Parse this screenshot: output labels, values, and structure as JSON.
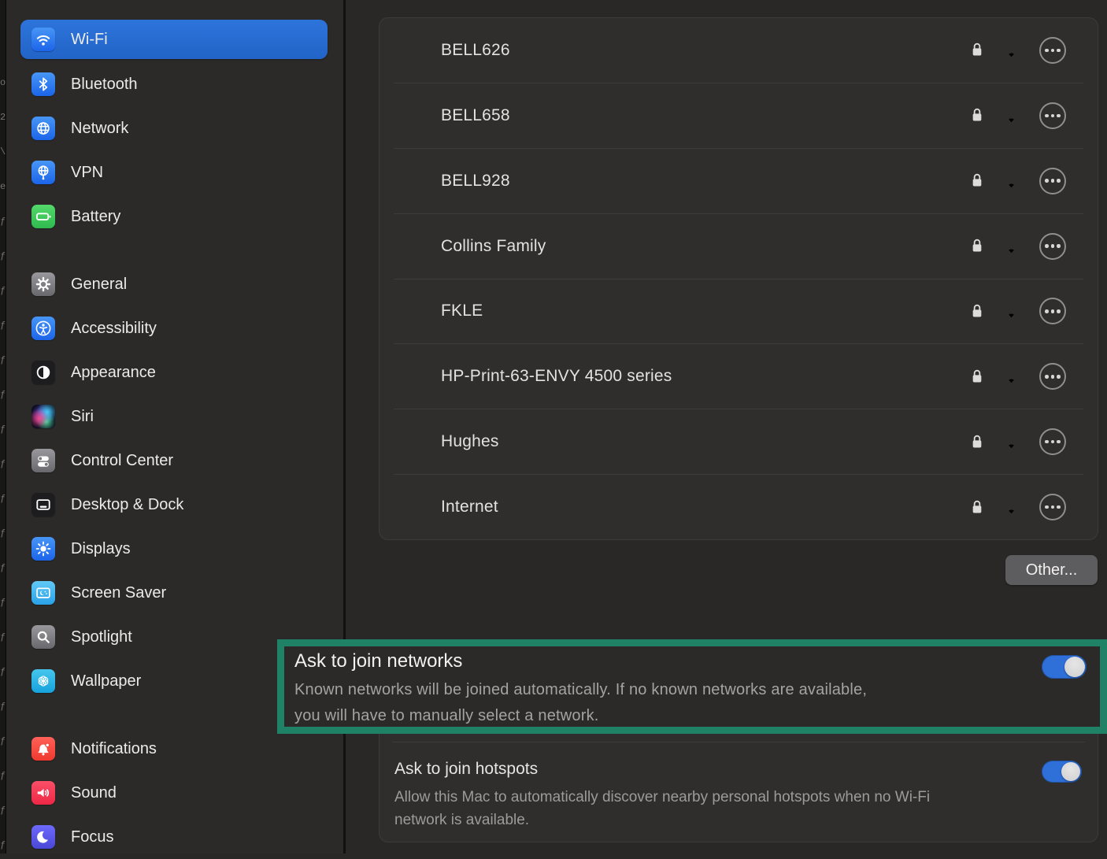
{
  "left_edge": {
    "chars": [
      "o",
      "2",
      "\\",
      "e",
      "ƒ",
      "ƒ",
      "ƒ",
      "ƒ",
      "ƒ",
      "ƒ",
      "ƒ",
      "ƒ",
      "ƒ",
      "ƒ",
      "ƒ",
      "ƒ",
      "ƒ",
      "ƒ",
      "ƒ",
      "ƒ",
      "ƒ",
      "ƒ",
      "ƒ"
    ]
  },
  "sidebar": {
    "sections": [
      {
        "items": [
          {
            "label": "Wi-Fi",
            "selected": true
          },
          {
            "label": "Bluetooth"
          },
          {
            "label": "Network"
          },
          {
            "label": "VPN"
          },
          {
            "label": "Battery"
          }
        ]
      },
      {
        "items": [
          {
            "label": "General"
          },
          {
            "label": "Accessibility"
          },
          {
            "label": "Appearance"
          },
          {
            "label": "Siri"
          },
          {
            "label": "Control Center"
          },
          {
            "label": "Desktop & Dock"
          },
          {
            "label": "Displays"
          },
          {
            "label": "Screen Saver"
          },
          {
            "label": "Spotlight"
          },
          {
            "label": "Wallpaper"
          }
        ]
      },
      {
        "items": [
          {
            "label": "Notifications"
          },
          {
            "label": "Sound"
          },
          {
            "label": "Focus"
          }
        ]
      }
    ]
  },
  "networks": {
    "rows": [
      {
        "name": "BELL626",
        "secured": true,
        "signal": 1
      },
      {
        "name": "BELL658",
        "secured": true,
        "signal": 2
      },
      {
        "name": "BELL928",
        "secured": true,
        "signal": 2
      },
      {
        "name": "Collins Family",
        "secured": true,
        "signal": 2
      },
      {
        "name": "FKLE",
        "secured": true,
        "signal": 2
      },
      {
        "name": "HP-Print-63-ENVY 4500 series",
        "secured": true,
        "signal": 2
      },
      {
        "name": "Hughes",
        "secured": true,
        "signal": 1
      },
      {
        "name": "Internet",
        "secured": true,
        "signal": 2
      }
    ],
    "other_button_label": "Other..."
  },
  "ask_to_join_networks": {
    "title": "Ask to join networks",
    "description": "Known networks will be joined automatically. If no known networks are available, you will have to manually select a network.",
    "toggle": "on"
  },
  "ask_to_join_hotspots": {
    "title": "Ask to join hotspots",
    "description": "Allow this Mac to automatically discover nearby personal hotspots when no Wi-Fi network is available.",
    "toggle": "on"
  },
  "annotation": {
    "highlight_color": "#1F8266"
  },
  "colors": {
    "selected_row_blue": "#2569CF",
    "toggle_on_blue": "#2E6FD8",
    "panel_bg": "#2F2E2C",
    "sidebar_bg": "#2B2A29"
  }
}
